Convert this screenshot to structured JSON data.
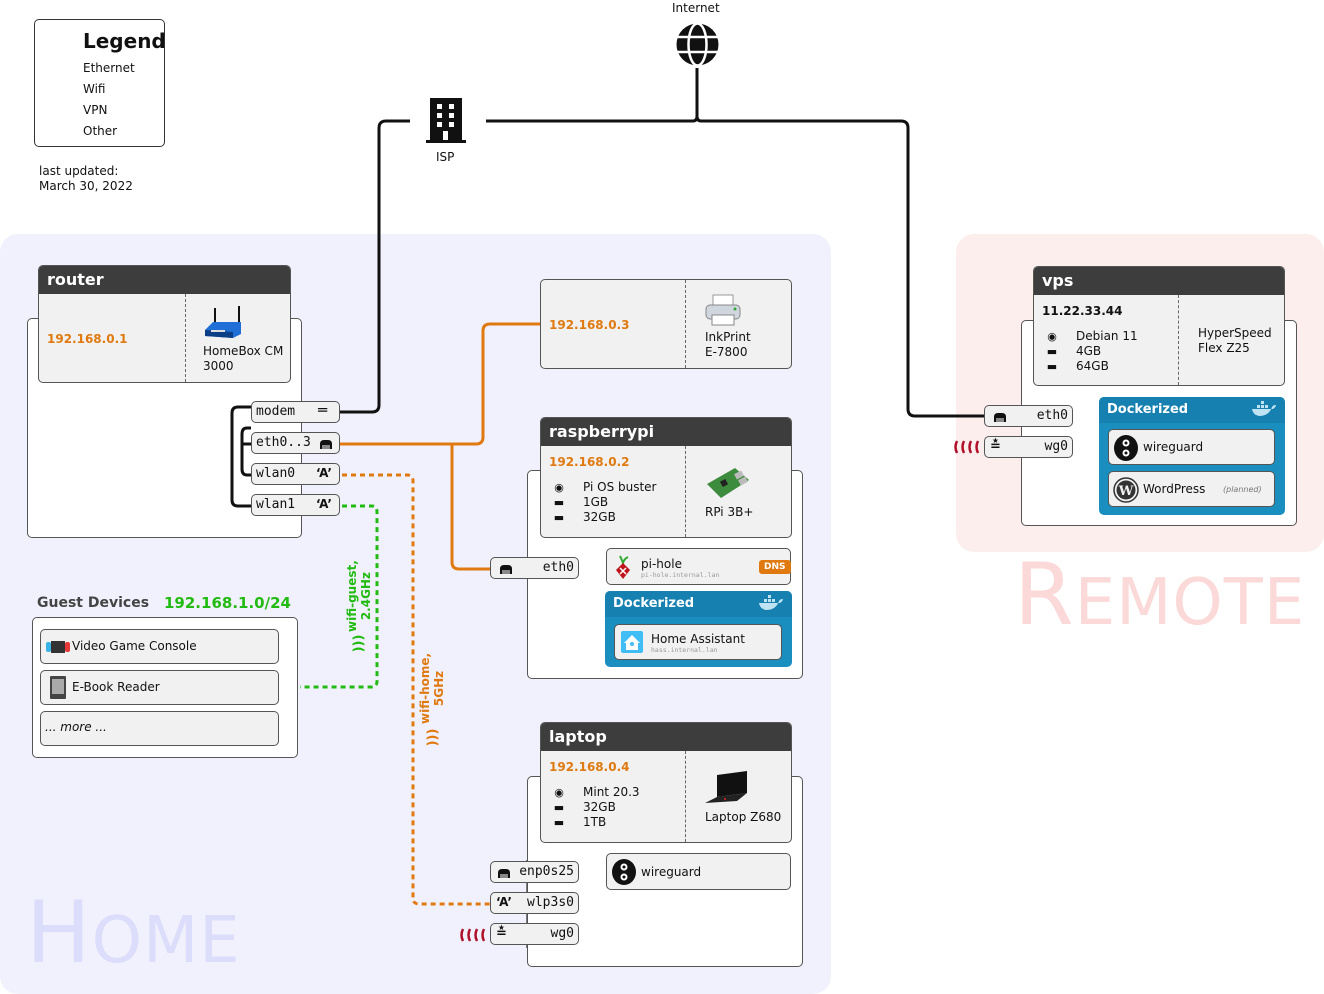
{
  "legend": {
    "title": "Legend",
    "items": [
      {
        "label": "Ethernet",
        "style": "solid"
      },
      {
        "label": "Wifi",
        "style": "dashed"
      },
      {
        "label": "VPN",
        "style": "vpn-arcs"
      },
      {
        "label": "Other",
        "style": "solid"
      }
    ]
  },
  "updated": {
    "line1": "last updated:",
    "line2": "March 30, 2022"
  },
  "internet": {
    "label": "Internet",
    "icon": "globe-icon"
  },
  "isp": {
    "label": "ISP",
    "icon": "building-icon"
  },
  "zones": {
    "home": {
      "first": "H",
      "rest": "OME"
    },
    "remote": {
      "first": "R",
      "rest": "EMOTE"
    }
  },
  "colors": {
    "home_bg": "#f1f1fd",
    "remote_bg": "#fdeeee",
    "ethernet_home": "#e07a10",
    "wifi_guest": "#22bb11",
    "vpn": "#b0102a",
    "docker": "#1a8fbf",
    "ip_home": "#e07a10"
  },
  "router": {
    "title": "router",
    "ip": "192.168.0.1",
    "model_line1": "HomeBox CM",
    "model_line2": "3000",
    "interfaces": [
      {
        "name": "modem",
        "icon": "equals-icon"
      },
      {
        "name": "eth0..3",
        "icon": "ethernet-port-icon"
      },
      {
        "name": "wlan0",
        "icon": "antenna-icon"
      },
      {
        "name": "wlan1",
        "icon": "antenna-icon"
      }
    ]
  },
  "printer": {
    "ip": "192.168.0.3",
    "model_line1": "InkPrint",
    "model_line2": "E-7800"
  },
  "raspberrypi": {
    "title": "raspberrypi",
    "ip": "192.168.0.2",
    "os": "Pi OS buster",
    "ram": "1GB",
    "disk": "32GB",
    "model": "RPi 3B+",
    "interface": "eth0",
    "services": [
      {
        "name": "pi-hole",
        "host": "pi-hole.internal.lan",
        "badge": "DNS"
      }
    ],
    "docker": {
      "title": "Dockerized",
      "services": [
        {
          "name": "Home Assistant",
          "host": "hass.internal.lan"
        }
      ]
    }
  },
  "laptop": {
    "title": "laptop",
    "ip": "192.168.0.4",
    "os": "Mint 20.3",
    "ram": "32GB",
    "disk": "1TB",
    "model": "Laptop Z680",
    "interfaces": [
      "enp0s25",
      "wlp3s0",
      "wg0"
    ],
    "services": [
      {
        "name": "wireguard"
      }
    ]
  },
  "guest": {
    "title": "Guest Devices",
    "subnet": "192.168.1.0/24",
    "devices": [
      "Video Game Console",
      "E-Book Reader",
      "... more ..."
    ]
  },
  "wifi_labels": {
    "guest_line1": "wifi-guest,",
    "guest_line2": "2.4GHz",
    "home_line1": "wifi-home,",
    "home_line2": "5GHz"
  },
  "vps": {
    "title": "vps",
    "ip": "11.22.33.44",
    "os": "Debian 11",
    "ram": "4GB",
    "disk": "64GB",
    "model_line1": "HyperSpeed",
    "model_line2": "Flex Z25",
    "interfaces": [
      "eth0",
      "wg0"
    ],
    "docker": {
      "title": "Dockerized",
      "services": [
        {
          "name": "wireguard",
          "note": ""
        },
        {
          "name": "WordPress",
          "note": "(planned)"
        }
      ]
    }
  }
}
